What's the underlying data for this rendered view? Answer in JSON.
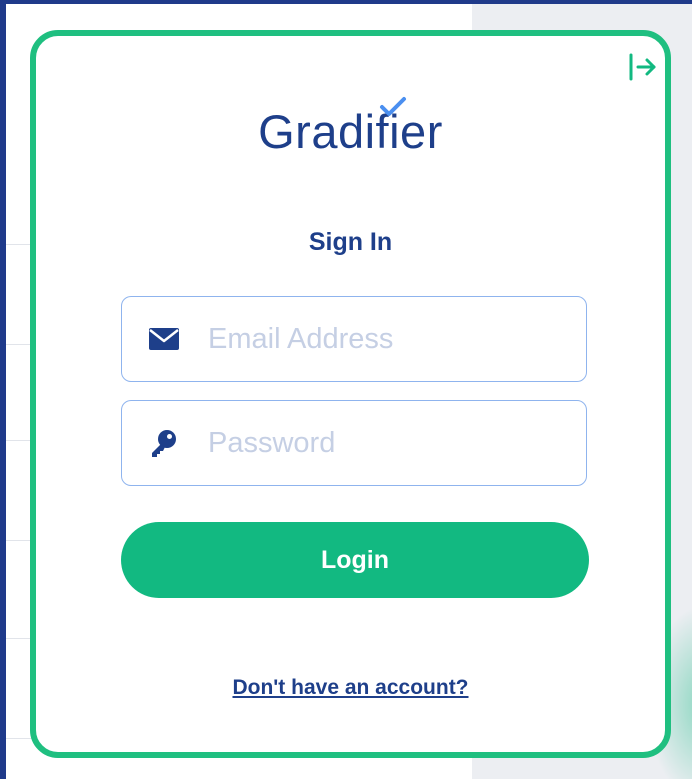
{
  "brand": {
    "name": "Gradifier",
    "primary_color": "#1e3f8a",
    "accent_color": "#12b981"
  },
  "header": {
    "exit_icon": "logout-arrow-icon"
  },
  "form": {
    "title": "Sign In",
    "email": {
      "icon": "envelope-icon",
      "value": "",
      "placeholder": "Email Address"
    },
    "password": {
      "icon": "key-icon",
      "value": "",
      "placeholder": "Password"
    },
    "login_label": "Login",
    "signup_link": "Don't have an account?"
  }
}
